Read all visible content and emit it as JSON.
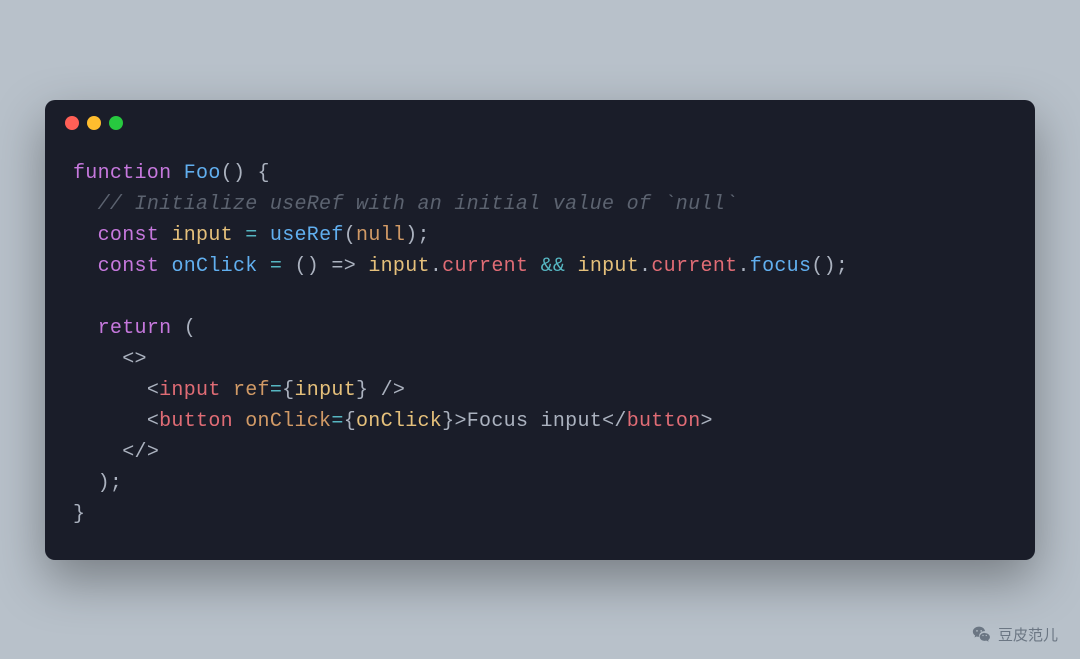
{
  "code": {
    "l1_function": "function",
    "l1_name": "Foo",
    "l1_paren": "() {",
    "l2_comment": "// Initialize useRef with an initial value of `null`",
    "l3_const": "const",
    "l3_var": "input",
    "l3_eq": "=",
    "l3_call": "useRef",
    "l3_open": "(",
    "l3_null": "null",
    "l3_close": ");",
    "l4_const": "const",
    "l4_var": "onClick",
    "l4_eq": "=",
    "l4_arrow": "() =>",
    "l4_obj1": "input",
    "l4_dot1": ".",
    "l4_prop1": "current",
    "l4_and": "&&",
    "l4_obj2": "input",
    "l4_dot2": ".",
    "l4_prop2": "current",
    "l4_dot3": ".",
    "l4_focus": "focus",
    "l4_call": "();",
    "l6_return": "return",
    "l6_paren": " (",
    "l7_frag": "<>",
    "l8_lt": "<",
    "l8_tag": "input",
    "l8_attr": "ref",
    "l8_eq": "=",
    "l8_lb": "{",
    "l8_val": "input",
    "l8_rb": "}",
    "l8_close": " />",
    "l9_lt": "<",
    "l9_tag": "button",
    "l9_attr": "onClick",
    "l9_eq": "=",
    "l9_lb": "{",
    "l9_val": "onClick",
    "l9_rb": "}",
    "l9_gt": ">",
    "l9_text": "Focus input",
    "l9_close_lt": "</",
    "l9_close_tag": "button",
    "l9_close_gt": ">",
    "l10_frag": "</>",
    "l11_close": ");",
    "l12_brace": "}"
  },
  "watermark": {
    "text": "豆皮范儿"
  }
}
